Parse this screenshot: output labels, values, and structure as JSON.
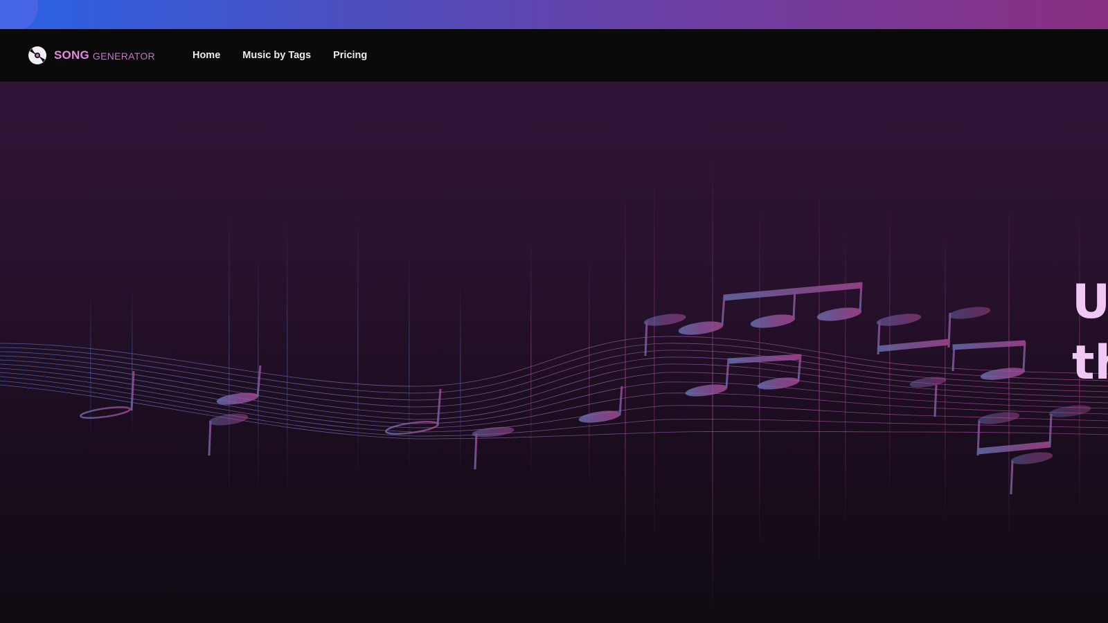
{
  "brand": {
    "name_strong": "SONG",
    "name_light": "GENERATOR",
    "logo_icon": "vinyl-disc-icon",
    "accent_color": "#e48be0"
  },
  "nav": {
    "links": [
      {
        "label": "Home"
      },
      {
        "label": "Music by Tags"
      },
      {
        "label": "Pricing"
      }
    ]
  },
  "hero": {
    "title_line1": "U",
    "title_line2": "th",
    "title_color": "#efc8f4",
    "background_art": "music-notes-wave-illustration"
  },
  "colors": {
    "banner_start": "#2a63e6",
    "banner_end": "#8a2f82",
    "navbar_bg": "#0a0a0b",
    "hero_top": "#331439",
    "hero_bottom": "#110b13"
  }
}
